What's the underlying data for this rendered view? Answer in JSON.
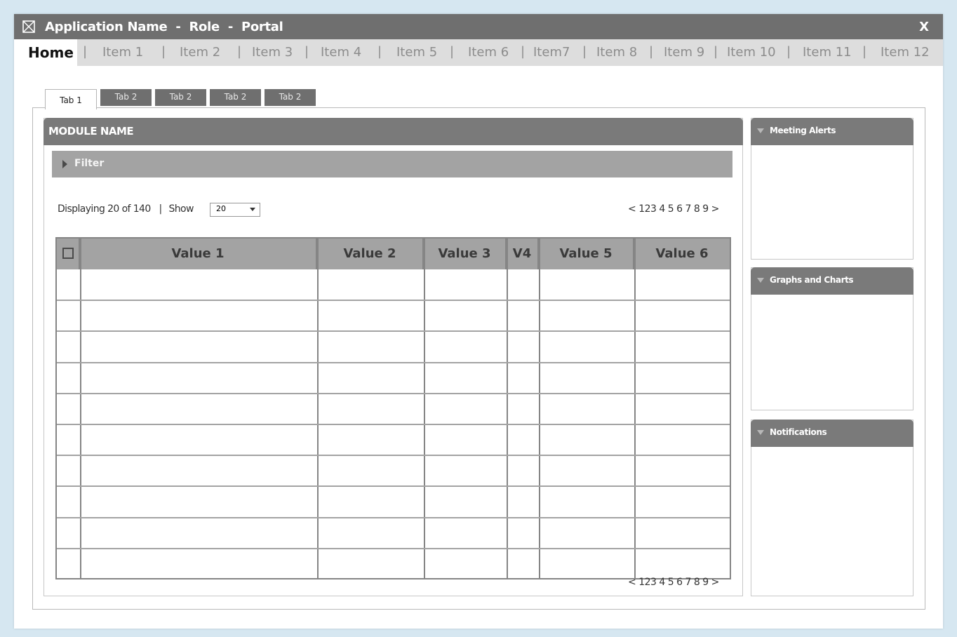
{
  "window": {
    "app_name": "Application Name",
    "role": "Role",
    "portal": "Portal",
    "separator": "-",
    "close_label": "X"
  },
  "menu": {
    "home": "Home",
    "separator": "|",
    "items": [
      "Item 1",
      "Item 2",
      "Item 3",
      "Item 4",
      "Item 5",
      "Item 6",
      "Item7",
      "Item 8",
      "Item 9",
      "Item 10",
      "Item 11",
      "Item 12"
    ]
  },
  "tabs": [
    "Tab 1",
    "Tab 2",
    "Tab 2",
    "Tab 2",
    "Tab 2"
  ],
  "module": {
    "name": "MODULE NAME",
    "filter_label": "Filter",
    "display_text": "Displaying 20 of 140",
    "display_separator": "|",
    "show_label": "Show",
    "show_value": "20",
    "pager": {
      "prev": "<",
      "pages": [
        "1",
        "2",
        "3",
        "4",
        "5",
        "6",
        "7",
        "8",
        "9"
      ],
      "next": ">"
    },
    "table": {
      "columns": [
        "Value 1",
        "Value 2",
        "Value 3",
        "V4",
        "Value 5",
        "Value 6"
      ],
      "row_count": 10
    }
  },
  "widgets": {
    "meeting_alerts": "Meeting Alerts",
    "graphs_charts": "Graphs and Charts",
    "notifications": "Notifications"
  }
}
